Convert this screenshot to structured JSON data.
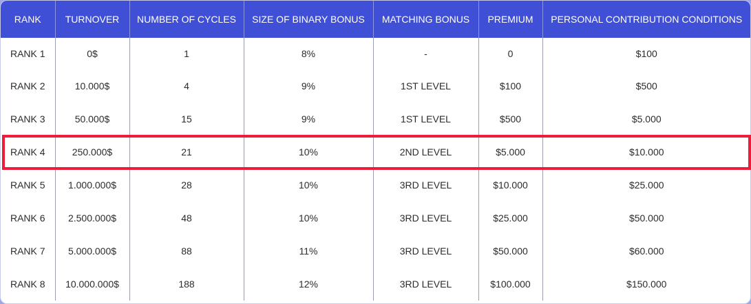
{
  "table": {
    "headers": [
      "RANK",
      "TURNOVER",
      "NUMBER OF CYCLES",
      "SIZE OF BINARY BONUS",
      "MATCHING BONUS",
      "PREMIUM",
      "PERSONAL CONTRIBUTION CONDITIONS"
    ],
    "rows": [
      [
        "RANK 1",
        "0$",
        "1",
        "8%",
        "-",
        "0",
        "$100"
      ],
      [
        "RANK 2",
        "10.000$",
        "4",
        "9%",
        "1ST LEVEL",
        "$100",
        "$500"
      ],
      [
        "RANK 3",
        "50.000$",
        "15",
        "9%",
        "1ST LEVEL",
        "$500",
        "$5.000"
      ],
      [
        "RANK 4",
        "250.000$",
        "21",
        "10%",
        "2ND LEVEL",
        "$5.000",
        "$10.000"
      ],
      [
        "RANK 5",
        "1.000.000$",
        "28",
        "10%",
        "3RD LEVEL",
        "$10.000",
        "$25.000"
      ],
      [
        "RANK 6",
        "2.500.000$",
        "48",
        "10%",
        "3RD LEVEL",
        "$25.000",
        "$50.000"
      ],
      [
        "RANK 7",
        "5.000.000$",
        "88",
        "11%",
        "3RD LEVEL",
        "$50.000",
        "$60.000"
      ],
      [
        "RANK 8",
        "10.000.000$",
        "188",
        "12%",
        "3RD LEVEL",
        "$100.000",
        "$150.000"
      ]
    ],
    "highlighted_row": "RANK 4"
  },
  "colors": {
    "header_bg": "#3f4fd6",
    "header_text": "#ffffff",
    "highlight_border": "#ee1c3b",
    "page_bg": "#9ea6e8"
  }
}
